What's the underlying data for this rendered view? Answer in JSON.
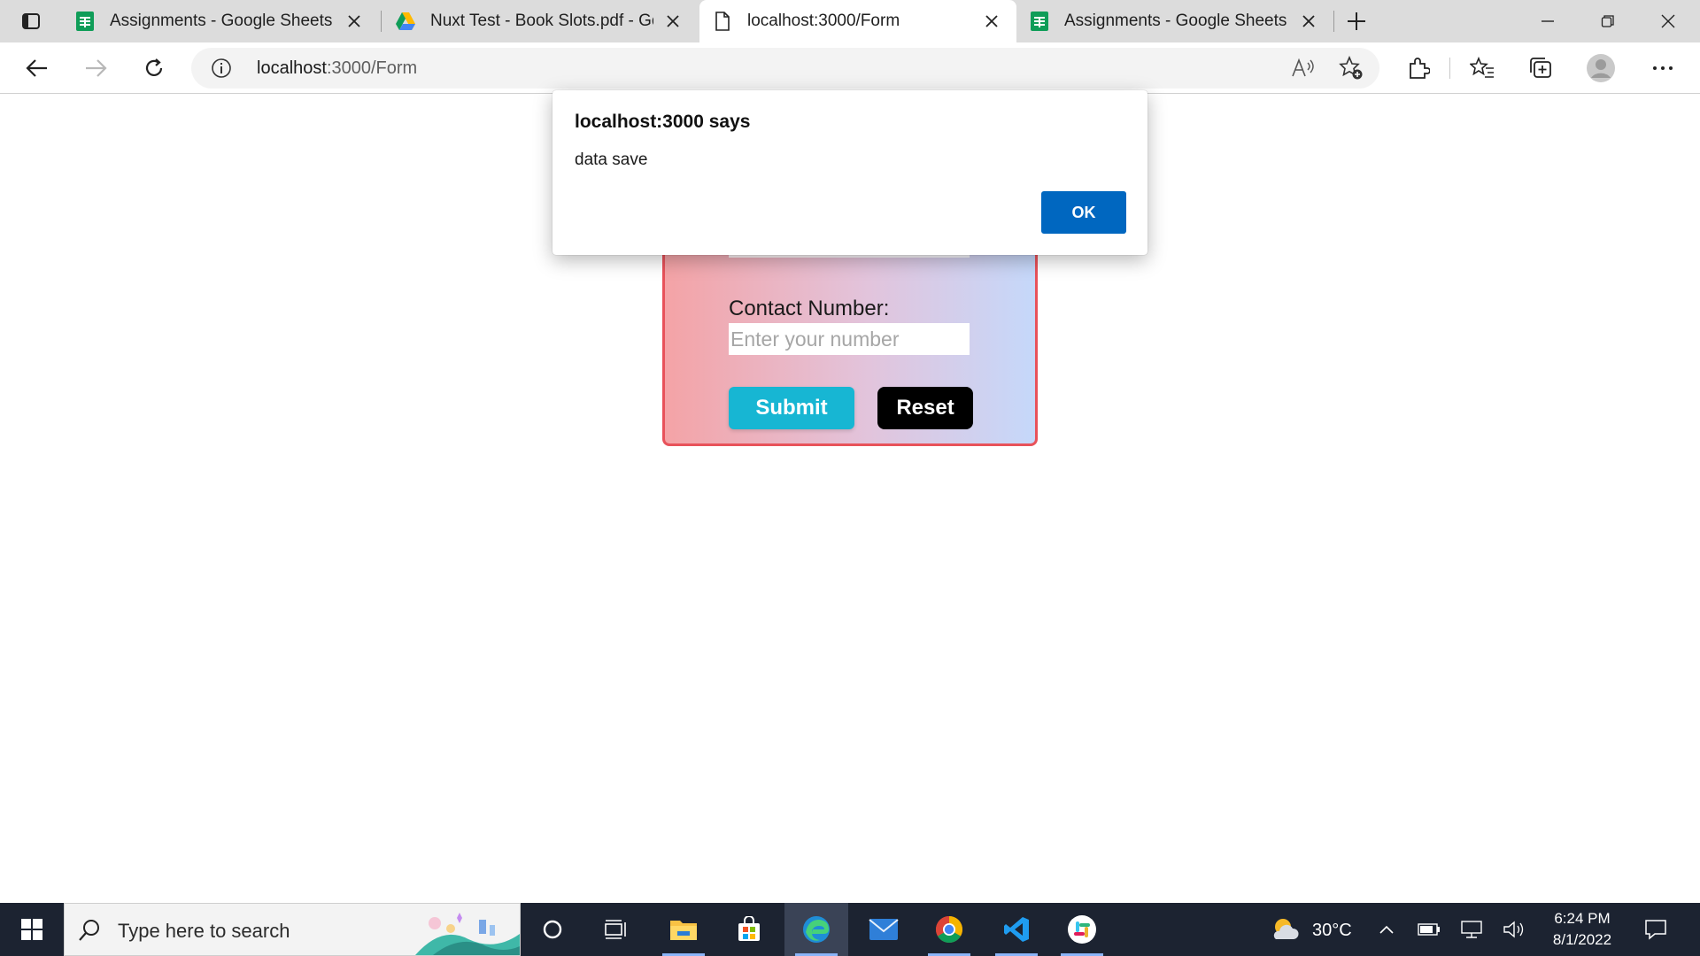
{
  "browser": {
    "tabs": [
      {
        "title": "Assignments - Google Sheets",
        "icon": "google-sheets-icon",
        "active": false
      },
      {
        "title": "Nuxt Test - Book Slots.pdf - Goo",
        "icon": "google-drive-icon",
        "active": false
      },
      {
        "title": "localhost:3000/Form",
        "icon": "page-icon",
        "active": true
      },
      {
        "title": "Assignments - Google Sheets",
        "icon": "google-sheets-icon",
        "active": false
      }
    ],
    "address": {
      "host": "localhost",
      "path": ":3000/Form"
    }
  },
  "form": {
    "contact_label": "Contact Number:",
    "contact_placeholder": "Enter your number",
    "submit_label": "Submit",
    "reset_label": "Reset",
    "accent_color": "#17b6d3",
    "border_color": "#e8525a"
  },
  "dialog": {
    "title": "localhost:3000 says",
    "message": "data save",
    "ok_label": "OK"
  },
  "taskbar": {
    "search_placeholder": "Type here to search",
    "weather": "30°C",
    "time": "6:24 PM",
    "date": "8/1/2022",
    "apps": [
      "cortana-icon",
      "task-view-icon",
      "file-explorer-icon",
      "microsoft-store-icon",
      "edge-icon",
      "mail-icon",
      "chrome-icon",
      "vscode-icon",
      "slack-icon"
    ]
  }
}
